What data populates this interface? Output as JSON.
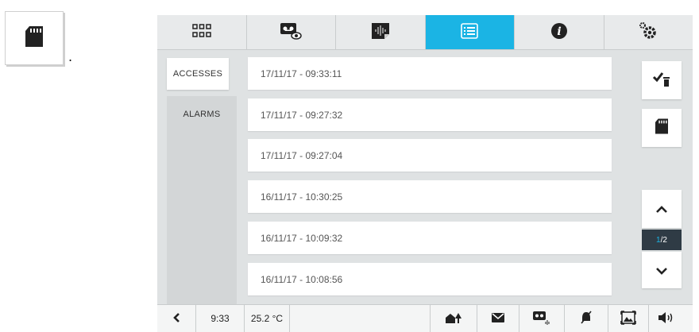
{
  "side_icon": {
    "name": "sd-card-icon",
    "trailing_dot": "."
  },
  "topbar": {
    "tabs": [
      {
        "name": "grid-icon"
      },
      {
        "name": "voicemail-view-icon"
      },
      {
        "name": "audio-message-icon"
      },
      {
        "name": "list-icon",
        "active": true
      },
      {
        "name": "info-icon"
      },
      {
        "name": "settings-icon"
      }
    ]
  },
  "left_nav": {
    "accesses": "ACCESSES",
    "alarms": "ALARMS"
  },
  "list": {
    "rows": [
      "17/11/17 - 09:33:11",
      "17/11/17 - 09:27:32",
      "17/11/17 - 09:27:04",
      "16/11/17 - 10:30:25",
      "16/11/17 - 10:09:32",
      "16/11/17 - 10:08:56"
    ]
  },
  "pager": {
    "current": "1",
    "sep_total": "/2"
  },
  "status": {
    "time": "9:33",
    "temperature": "25.2 °C"
  },
  "colors": {
    "accent": "#1bb4e4",
    "panel": "#dfe2e3",
    "pager_bg": "#2f3b45"
  }
}
